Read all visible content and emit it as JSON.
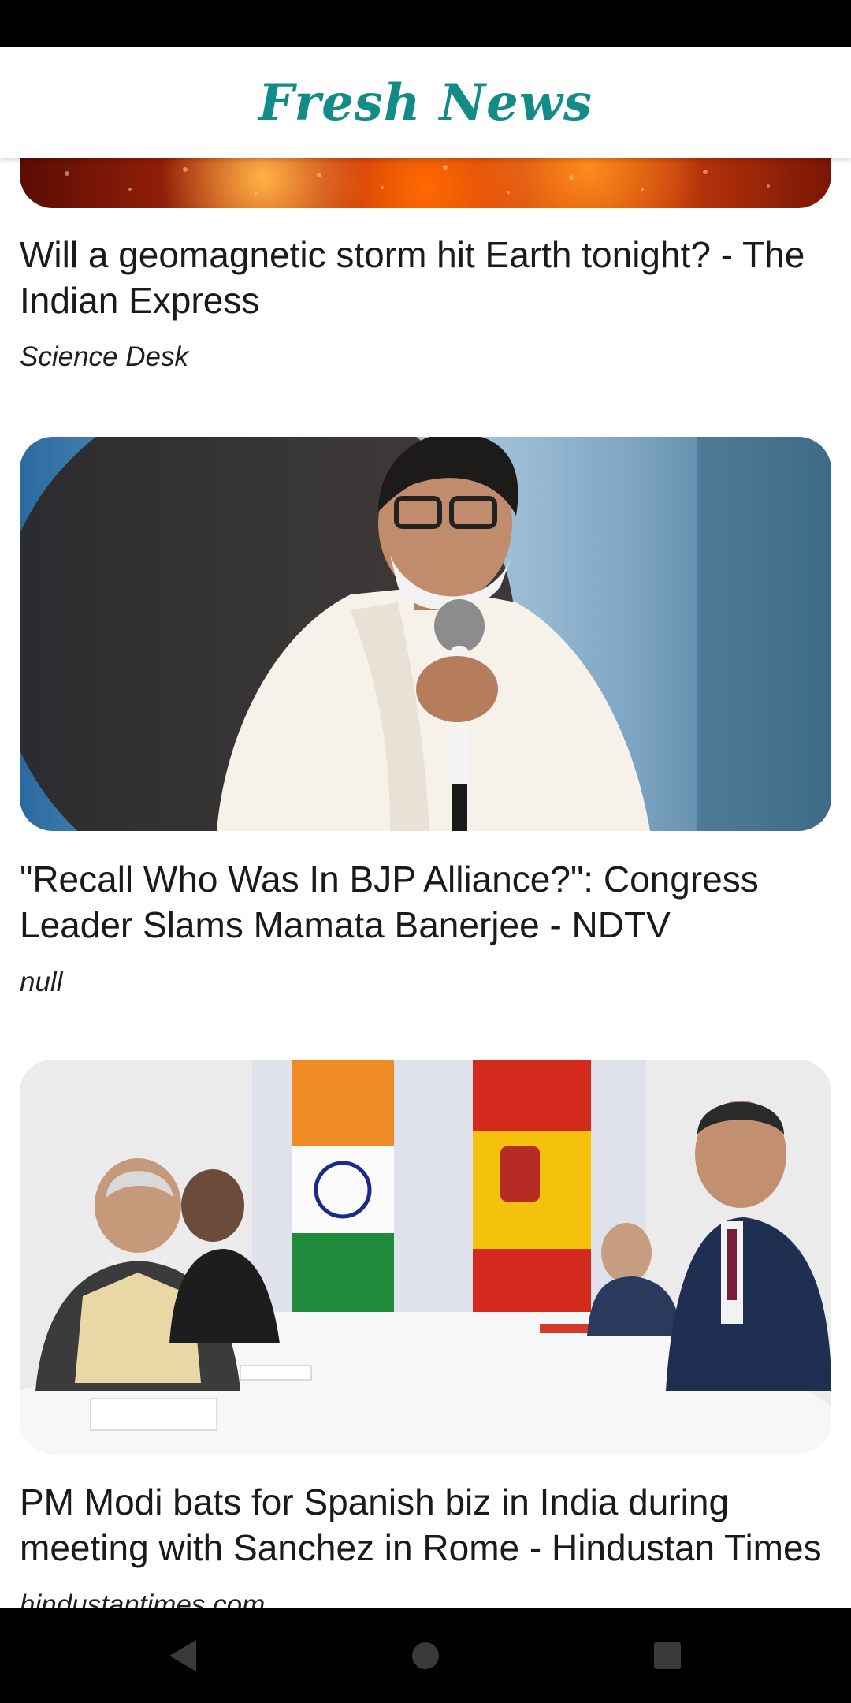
{
  "app": {
    "title": "Fresh News",
    "accent_color": "#138b87"
  },
  "articles": [
    {
      "title": "Will a geomagnetic storm hit Earth tonight? - The Indian Express",
      "source": "Science Desk",
      "image": "solar-storm-image"
    },
    {
      "title": "\"Recall Who Was In BJP Alliance?\": Congress Leader Slams Mamata Banerjee - NDTV",
      "source": "null",
      "image": "woman-speaking-into-microphone-image"
    },
    {
      "title": "PM Modi bats for Spanish biz in India during meeting with Sanchez in Rome - Hindustan Times",
      "source": "hindustantimes.com",
      "image": "bilateral-meeting-with-flags-image"
    }
  ],
  "nav": {
    "back_icon": "back-triangle-icon",
    "home_icon": "home-circle-icon",
    "recents_icon": "recents-square-icon"
  }
}
